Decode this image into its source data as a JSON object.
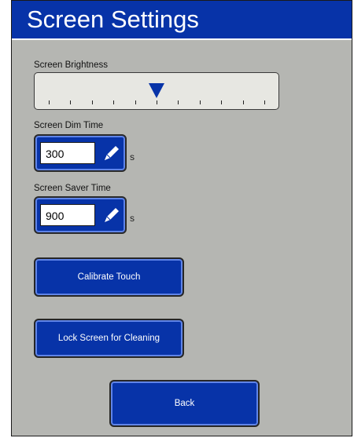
{
  "header": {
    "title": "Screen Settings"
  },
  "brightness": {
    "label": "Screen Brightness",
    "level_fraction": 0.5
  },
  "dim_time": {
    "label": "Screen Dim Time",
    "value": "300",
    "unit": "s"
  },
  "saver_time": {
    "label": "Screen Saver Time",
    "value": "900",
    "unit": "s"
  },
  "buttons": {
    "calibrate": "Calibrate Touch",
    "lock": "Lock Screen for Cleaning",
    "back": "Back"
  },
  "icons": {
    "slider_thumb": "triangle-down-icon",
    "edit": "pencil-icon"
  },
  "colors": {
    "accent_blue": "#0733a8",
    "panel_gray": "#b5b6b2",
    "slider_bg": "#e7e7e2"
  }
}
